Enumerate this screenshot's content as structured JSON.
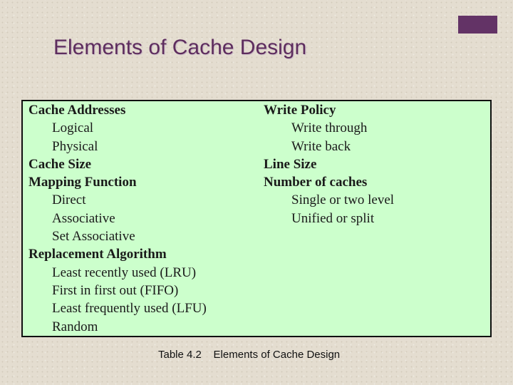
{
  "slide": {
    "title": "Elements of Cache Design",
    "accent_color": "#633366",
    "table_background": "#ccffcc",
    "caption": "Table 4.2    Elements of Cache Design"
  },
  "table": {
    "left_column": [
      {
        "text": "Cache Addresses",
        "level": "head"
      },
      {
        "text": "Logical",
        "level": "sub"
      },
      {
        "text": "Physical",
        "level": "sub"
      },
      {
        "text": "Cache Size",
        "level": "head"
      },
      {
        "text": "Mapping Function",
        "level": "head"
      },
      {
        "text": "Direct",
        "level": "sub"
      },
      {
        "text": "Associative",
        "level": "sub"
      },
      {
        "text": "Set Associative",
        "level": "sub"
      },
      {
        "text": "Replacement Algorithm",
        "level": "head"
      },
      {
        "text": "Least recently used (LRU)",
        "level": "sub"
      },
      {
        "text": "First in first out (FIFO)",
        "level": "sub"
      },
      {
        "text": "Least frequently used (LFU)",
        "level": "sub"
      },
      {
        "text": "Random",
        "level": "sub"
      }
    ],
    "right_column": [
      {
        "text": "Write Policy",
        "level": "head"
      },
      {
        "text": "Write through",
        "level": "sub"
      },
      {
        "text": "Write back",
        "level": "sub"
      },
      {
        "text": "Line Size",
        "level": "head"
      },
      {
        "text": "Number of caches",
        "level": "head"
      },
      {
        "text": "Single or two level",
        "level": "sub"
      },
      {
        "text": "Unified or split",
        "level": "sub"
      }
    ]
  }
}
